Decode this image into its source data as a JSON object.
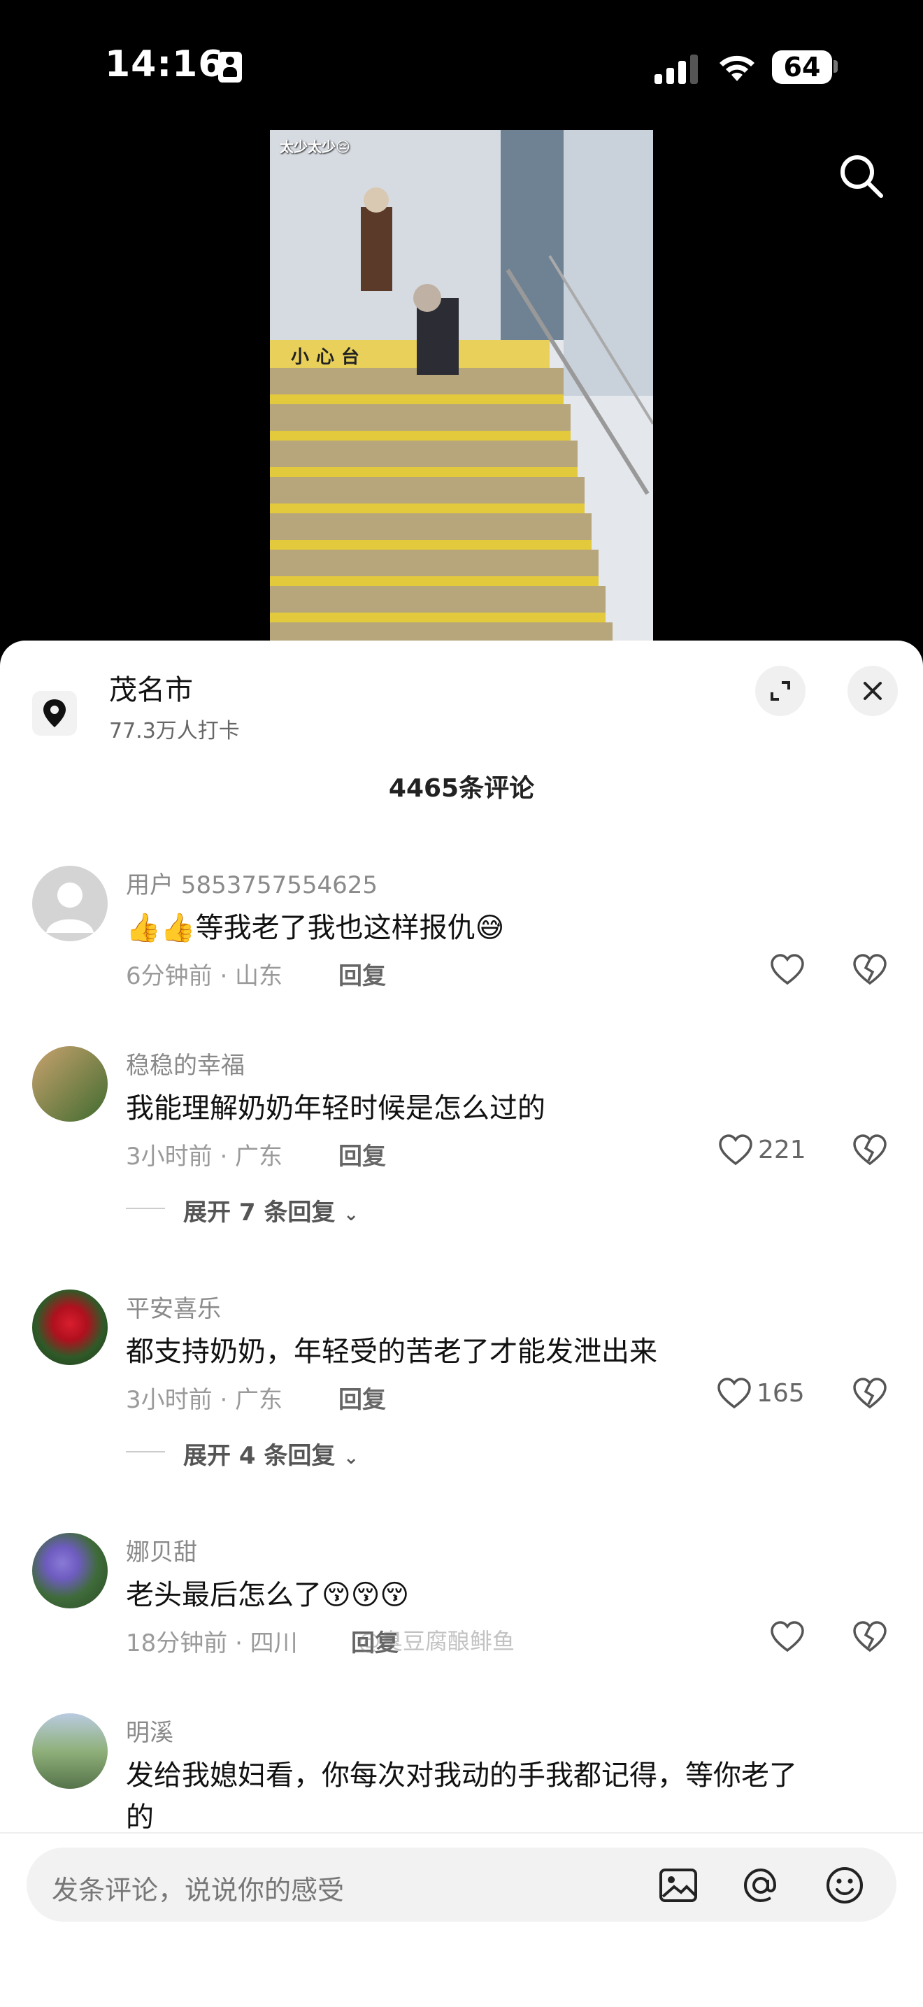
{
  "status_bar": {
    "time": "14:16",
    "battery": "64"
  },
  "video": {
    "caption": "太少太少😔",
    "floor_sign": "小心台"
  },
  "location": {
    "name": "茂名市",
    "checkins": "77.3万人打卡"
  },
  "comments_header": {
    "count_label": "4465条评论"
  },
  "comments": [
    {
      "user": "用户 5853757554625",
      "text": "👍👍等我老了我也这样报仇😅",
      "meta": "6分钟前 · 山东",
      "reply": "回复",
      "likes": ""
    },
    {
      "user": "稳稳的幸福",
      "text": "我能理解奶奶年轻时候是怎么过的",
      "meta": "3小时前 · 广东",
      "reply": "回复",
      "likes": "221",
      "expand": "展开 7 条回复"
    },
    {
      "user": "平安喜乐",
      "text": "都支持奶奶，年轻受的苦老了才能发泄出来",
      "meta": "3小时前 · 广东",
      "reply": "回复",
      "likes": "165",
      "expand": "展开 4 条回复"
    },
    {
      "user": "娜贝甜",
      "text": "老头最后怎么了😚😚😚",
      "meta": "18分钟前 · 四川",
      "reply": "回复",
      "likes": ""
    },
    {
      "user": "明溪",
      "text": "发给我媳妇看，你每次对我动的手我都记得，等你老了",
      "text2": "的",
      "meta": "",
      "reply": "",
      "likes": ""
    }
  ],
  "watermark": "@臭豆腐酿鲱鱼",
  "input": {
    "placeholder": "发条评论，说说你的感受"
  },
  "icons": [
    "location-pin-icon",
    "expand-icon",
    "close-icon",
    "search-icon",
    "heart-icon",
    "dislike-icon",
    "image-icon",
    "at-icon",
    "emoji-icon",
    "chevron-down-icon"
  ]
}
